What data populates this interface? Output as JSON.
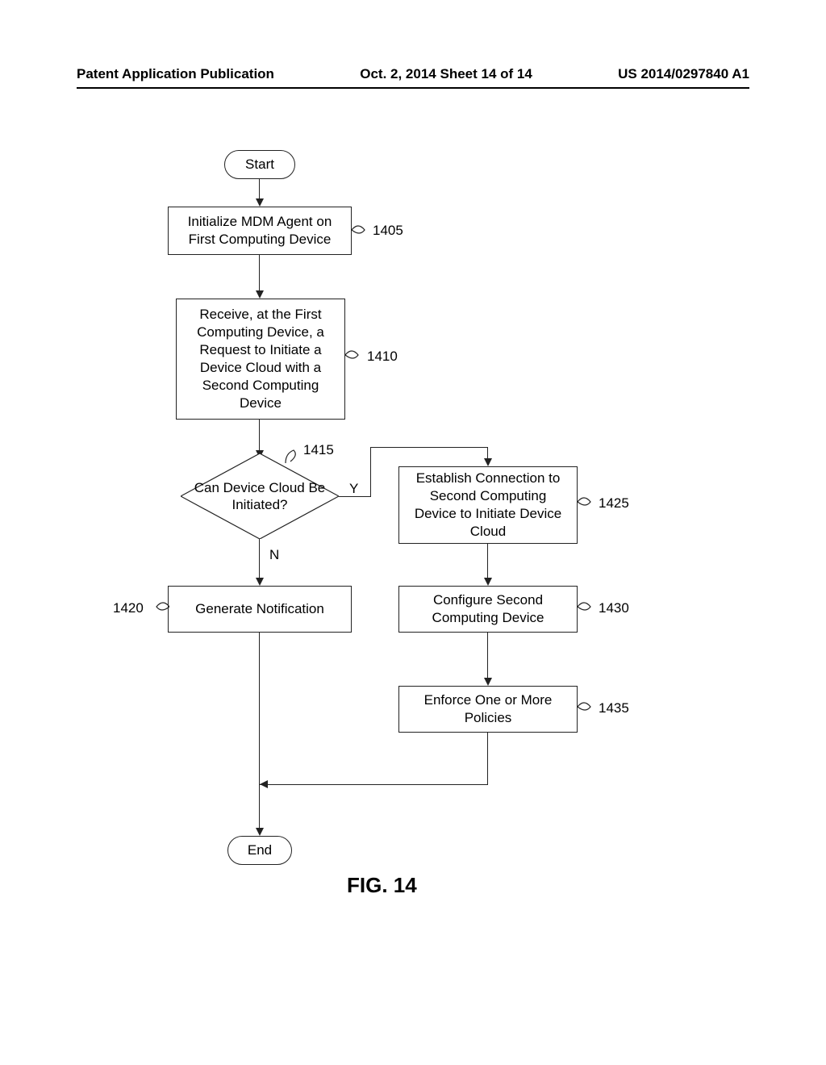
{
  "header": {
    "left": "Patent Application Publication",
    "center": "Oct. 2, 2014  Sheet 14 of 14",
    "right": "US 2014/0297840 A1"
  },
  "nodes": {
    "start": "Start",
    "end": "End",
    "n1405": "Initialize MDM Agent on First Computing Device",
    "n1410": "Receive, at the First Computing Device, a Request to Initiate a Device Cloud with a Second Computing Device",
    "n1415": "Can Device Cloud Be Initiated?",
    "n1420": "Generate Notification",
    "n1425": "Establish Connection to Second Computing Device to Initiate Device Cloud",
    "n1430": "Configure Second Computing Device",
    "n1435": "Enforce One or More Policies"
  },
  "refs": {
    "r1405": "1405",
    "r1410": "1410",
    "r1415": "1415",
    "r1420": "1420",
    "r1425": "1425",
    "r1430": "1430",
    "r1435": "1435"
  },
  "branches": {
    "yes": "Y",
    "no": "N"
  },
  "figure_caption": "FIG. 14"
}
